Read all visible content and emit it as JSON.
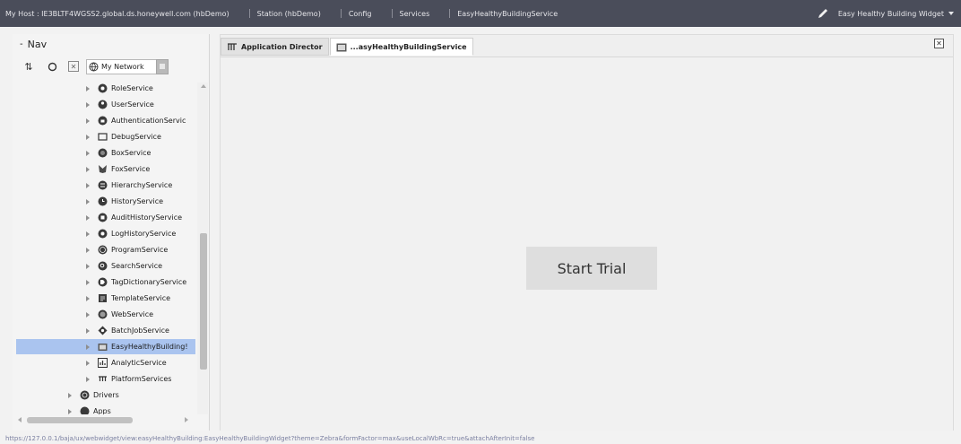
{
  "topbar": {
    "crumbs": [
      "My Host : IE3BLTF4WGSS2.global.ds.honeywell.com (hbDemo)",
      "Station (hbDemo)",
      "Config",
      "Services",
      "EasyHealthyBuildingService"
    ],
    "widget_label": "Easy Healthy Building Widget"
  },
  "nav": {
    "title": "Nav",
    "network_select": "My Network",
    "tree": [
      {
        "label": "RoleService",
        "icon": "role-icon"
      },
      {
        "label": "UserService",
        "icon": "user-icon"
      },
      {
        "label": "AuthenticationServic",
        "icon": "auth-icon"
      },
      {
        "label": "DebugService",
        "icon": "debug-icon"
      },
      {
        "label": "BoxService",
        "icon": "box-icon"
      },
      {
        "label": "FoxService",
        "icon": "fox-icon"
      },
      {
        "label": "HierarchyService",
        "icon": "hierarchy-icon"
      },
      {
        "label": "HistoryService",
        "icon": "history-icon"
      },
      {
        "label": "AuditHistoryService",
        "icon": "audit-icon"
      },
      {
        "label": "LogHistoryService",
        "icon": "log-icon"
      },
      {
        "label": "ProgramService",
        "icon": "program-icon"
      },
      {
        "label": "SearchService",
        "icon": "search-icon"
      },
      {
        "label": "TagDictionaryService",
        "icon": "tag-icon"
      },
      {
        "label": "TemplateService",
        "icon": "template-icon"
      },
      {
        "label": "WebService",
        "icon": "web-icon"
      },
      {
        "label": "BatchJobService",
        "icon": "batch-icon"
      },
      {
        "label": "EasyHealthyBuilding!",
        "icon": "folder-icon"
      },
      {
        "label": "AnalyticService",
        "icon": "analytic-icon"
      },
      {
        "label": "PlatformServices",
        "icon": "platform-icon"
      },
      {
        "label": "Drivers",
        "icon": "drivers-icon"
      },
      {
        "label": "Apps",
        "icon": "apps-icon"
      }
    ]
  },
  "tabs": [
    {
      "label": "Application Director"
    },
    {
      "label": "...asyHealthyBuildingService"
    }
  ],
  "main": {
    "start_trial_label": "Start Trial"
  },
  "status_url": "https://127.0.0.1/baja/ux/webwidget/view:easyHealthyBuilding:EasyHealthyBuildingWidget?theme=Zebra&formFactor=max&useLocalWbRc=true&attachAfterInit=false",
  "colors": {
    "topbar_bg": "#4a4d5a",
    "selected_row": "#aac4ef",
    "button_bg": "#dedede"
  }
}
